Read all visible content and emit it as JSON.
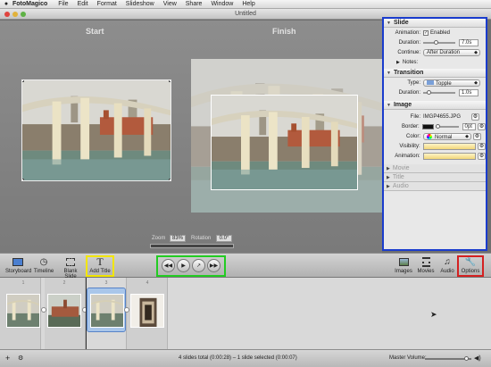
{
  "menubar": {
    "apple": "",
    "items": [
      "FotoMagico",
      "File",
      "Edit",
      "Format",
      "Slideshow",
      "View",
      "Share",
      "Window",
      "Help"
    ]
  },
  "window": {
    "title": "Untitled"
  },
  "stage": {
    "start_label": "Start",
    "finish_label": "Finish",
    "zoom_label": "Zoom",
    "zoom_value": "83%",
    "rotation_label": "Rotation",
    "rotation_value": "0.0°"
  },
  "inspector": {
    "slide": {
      "heading": "Slide",
      "animation_label": "Animation:",
      "animation_checkbox": "Enabled",
      "duration_label": "Duration:",
      "duration_value": "7.0s",
      "continue_label": "Continue:",
      "continue_value": "After Duration",
      "notes_label": "Notes:"
    },
    "transition": {
      "heading": "Transition",
      "type_label": "Type:",
      "type_value": "Topple",
      "duration_label": "Duration:",
      "duration_value": "1.0s"
    },
    "image": {
      "heading": "Image",
      "file_label": "File:",
      "file_value": "IMGP4655.JPG",
      "border_label": "Border:",
      "border_value": "0pt",
      "color_label": "Color:",
      "color_value": "Normal",
      "visibility_label": "Visibility:",
      "animation_label": "Animation:"
    },
    "collapsed": [
      "Movie",
      "Title",
      "Audio"
    ]
  },
  "toolbar": {
    "storyboard": "Storyboard",
    "timeline": "Timeline",
    "blank_slide": "Blank Slide",
    "add_title": "Add Title",
    "images": "Images",
    "movies": "Movies",
    "audio": "Audio",
    "options": "Options"
  },
  "storyboard": {
    "slides": [
      {
        "number": "1"
      },
      {
        "number": "2"
      },
      {
        "number": "3"
      },
      {
        "number": "4"
      }
    ]
  },
  "status": {
    "summary": "4 slides total (0:00:28) – 1 slide selected (0:00:07)",
    "master_volume": "Master Volume:"
  },
  "colors": {
    "highlight_blue": "#1a3ccd",
    "highlight_yellow": "#f2e600",
    "highlight_green": "#22cc22",
    "highlight_red": "#d42121",
    "selection": "#a9c6ea"
  }
}
